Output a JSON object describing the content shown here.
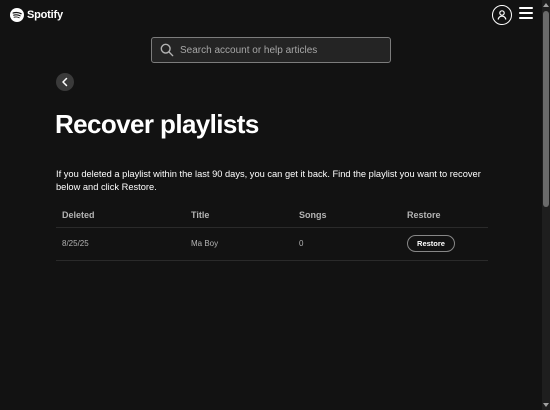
{
  "header": {
    "logo_text": "Spotify",
    "logo_icon": "spotify-logo-icon",
    "profile_icon": "user-icon",
    "menu_icon": "hamburger-menu-icon"
  },
  "search": {
    "placeholder": "Search account or help articles",
    "value": "",
    "icon": "search-icon"
  },
  "back": {
    "icon": "chevron-left-icon"
  },
  "page": {
    "title": "Recover playlists",
    "description": "If you deleted a playlist within the last 90 days, you can get it back. Find the playlist you want to recover below and click Restore."
  },
  "table": {
    "columns": [
      "Deleted",
      "Title",
      "Songs",
      "Restore"
    ],
    "rows": [
      {
        "deleted": "8/25/25",
        "title": "Ma Boy",
        "songs": "0",
        "action": "Restore"
      }
    ]
  },
  "colors": {
    "background": "#121212",
    "text": "#ffffff",
    "muted_text": "#b3b3b3",
    "search_bg": "#242424",
    "divider": "#2a2a2a"
  }
}
